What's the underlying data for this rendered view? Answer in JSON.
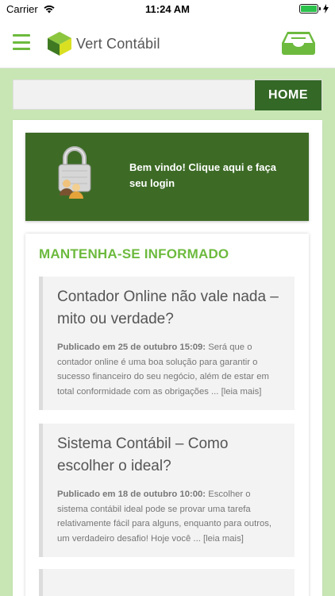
{
  "status": {
    "carrier": "Carrier",
    "time": "11:24 AM"
  },
  "header": {
    "app_name": "Vert Contábil"
  },
  "search": {
    "placeholder": "",
    "home_label": "HOME"
  },
  "login": {
    "text": "Bem vindo! Clique aqui e faça seu login"
  },
  "news": {
    "heading": "MANTENHA-SE INFORMADO",
    "posts": [
      {
        "title": "Contador Online não vale nada – mito ou verdade?",
        "date": "Publicado em 25 de outubro 15:09:",
        "excerpt": "Será que o contador online é uma boa solução para garantir o sucesso financeiro do seu negócio, além de estar em total conformidade com as obrigações ...",
        "more": "[leia mais]"
      },
      {
        "title": "Sistema Contábil – Como escolher o ideal?",
        "date": "Publicado em 18 de outubro 10:00:",
        "excerpt": "Escolher o sistema contábil ideal pode se provar uma tarefa relativamente fácil para alguns, enquanto para outros, um verdadeiro desafio! Hoje você ...",
        "more": "[leia mais]"
      }
    ]
  },
  "colors": {
    "brand_green": "#6dba3e",
    "dark_green": "#346826",
    "background": "#c8e6b4"
  }
}
